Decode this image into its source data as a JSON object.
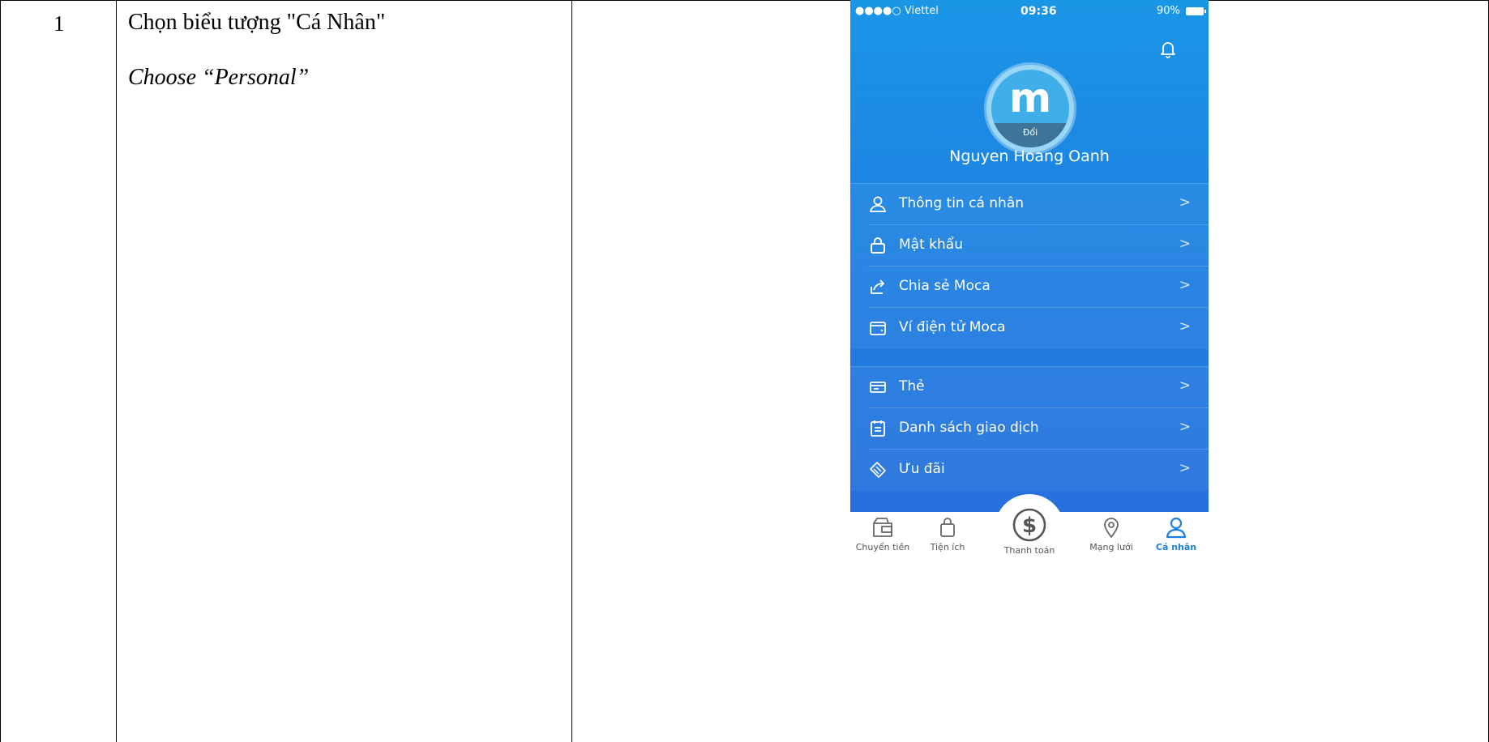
{
  "row": {
    "number": "1",
    "step_vi": "Chọn biểu tượng \"Cá Nhân\"",
    "step_en": "Choose “Personal”"
  },
  "phone": {
    "status": {
      "carrier": "●●●●○ Viettel",
      "time": "09:36",
      "battery": "90%"
    },
    "avatar": {
      "letter": "m",
      "change_label": "Đổi"
    },
    "user_name": "Nguyen Hoang Oanh",
    "menu_group1": [
      {
        "label": "Thông tin cá nhân",
        "icon": "user-icon"
      },
      {
        "label": "Mật khẩu",
        "icon": "lock-icon"
      },
      {
        "label": "Chia sẻ Moca",
        "icon": "share-icon"
      },
      {
        "label": "Ví điện tử Moca",
        "icon": "wallet-icon"
      }
    ],
    "menu_group2": [
      {
        "label": "Thẻ",
        "icon": "card-icon"
      },
      {
        "label": "Danh sách giao dịch",
        "icon": "list-icon"
      },
      {
        "label": "Ưu đãi",
        "icon": "tag-icon"
      }
    ],
    "chevron": ">",
    "tabs": [
      {
        "label": "Chuyển tiền",
        "icon": "transfer-icon"
      },
      {
        "label": "Tiện ích",
        "icon": "bag-icon"
      },
      {
        "label": "Thanh toán",
        "icon": "dollar-icon"
      },
      {
        "label": "Mạng lưới",
        "icon": "location-icon"
      },
      {
        "label": "Cá nhân",
        "icon": "person-icon",
        "active": true
      }
    ],
    "colors": {
      "accent": "#1d7fe0",
      "gradient_top": "#1a96e6",
      "gradient_bottom": "#2670dd"
    }
  }
}
